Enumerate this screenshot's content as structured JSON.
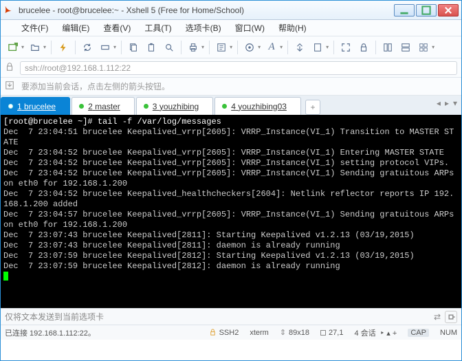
{
  "window": {
    "title": "brucelee - root@brucelee:~ - Xshell 5 (Free for Home/School)"
  },
  "menu": {
    "file": "文件(F)",
    "edit": "编辑(E)",
    "view": "查看(V)",
    "tools": "工具(T)",
    "tabs": "选项卡(B)",
    "window": "窗口(W)",
    "help": "帮助(H)"
  },
  "address": "ssh://root@192.168.1.112:22",
  "infobar": "要添加当前会话，点击左侧的箭头按钮。",
  "tabs": [
    {
      "num": "1",
      "label": "brucelee",
      "active": true
    },
    {
      "num": "2",
      "label": "master",
      "active": false
    },
    {
      "num": "3",
      "label": "youzhibing",
      "active": false
    },
    {
      "num": "4",
      "label": "youzhibing03",
      "active": false
    }
  ],
  "terminal": {
    "prompt": "[root@brucelee ~]# ",
    "cmd": "tail -f /var/log/messages",
    "lines": [
      "Dec  7 23:04:51 brucelee Keepalived_vrrp[2605]: VRRP_Instance(VI_1) Transition to MASTER STATE",
      "Dec  7 23:04:52 brucelee Keepalived_vrrp[2605]: VRRP_Instance(VI_1) Entering MASTER STATE",
      "Dec  7 23:04:52 brucelee Keepalived_vrrp[2605]: VRRP_Instance(VI_1) setting protocol VIPs.",
      "Dec  7 23:04:52 brucelee Keepalived_vrrp[2605]: VRRP_Instance(VI_1) Sending gratuitous ARPs on eth0 for 192.168.1.200",
      "Dec  7 23:04:52 brucelee Keepalived_healthcheckers[2604]: Netlink reflector reports IP 192.168.1.200 added",
      "Dec  7 23:04:57 brucelee Keepalived_vrrp[2605]: VRRP_Instance(VI_1) Sending gratuitous ARPs on eth0 for 192.168.1.200",
      "Dec  7 23:07:43 brucelee Keepalived[2811]: Starting Keepalived v1.2.13 (03/19,2015)",
      "Dec  7 23:07:43 brucelee Keepalived[2811]: daemon is already running",
      "Dec  7 23:07:59 brucelee Keepalived[2812]: Starting Keepalived v1.2.13 (03/19,2015)",
      "Dec  7 23:07:59 brucelee Keepalived[2812]: daemon is already running"
    ]
  },
  "sendbar": "仅将文本发送到当前选项卡",
  "status": {
    "conn": "已连接 192.168.1.112:22。",
    "ssh": "SSH2",
    "term": "xterm",
    "size": "89x18",
    "pos": "27,1",
    "sessions": "4 会话",
    "caps": "CAP",
    "num": "NUM"
  }
}
